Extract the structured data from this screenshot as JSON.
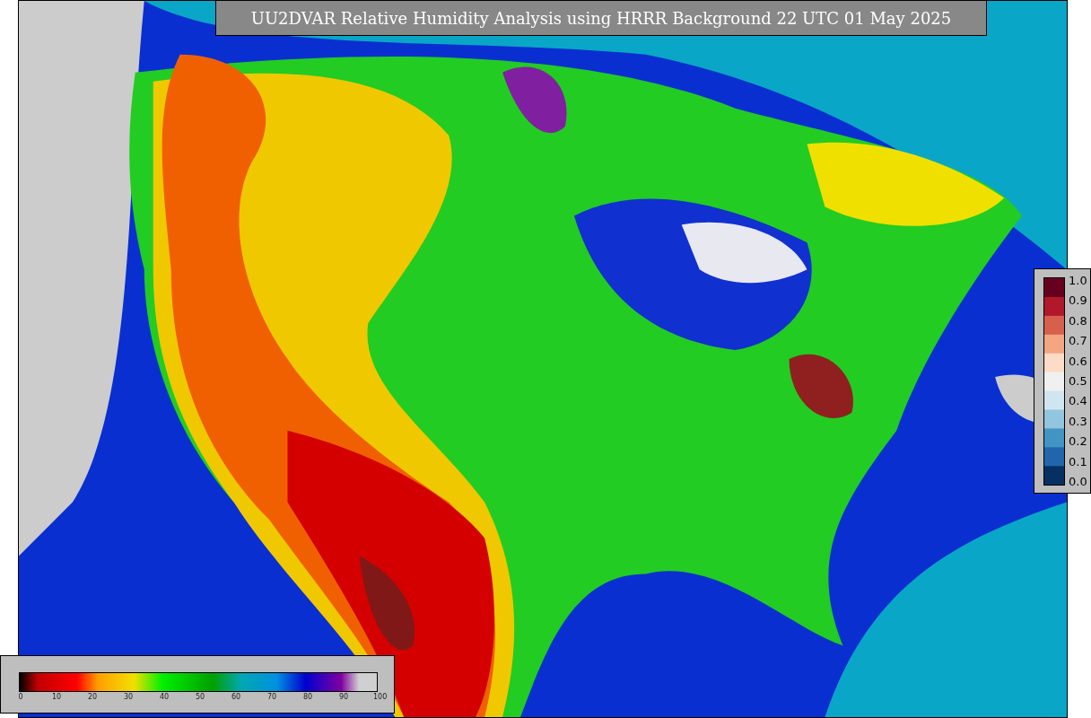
{
  "title": "UU2DVAR Relative Humidity Analysis using HRRR Background 22 UTC 01 May 2025",
  "station_legend": {
    "ticks": [
      "1.0",
      "0.9",
      "0.8",
      "0.7",
      "0.6",
      "0.5",
      "0.4",
      "0.3",
      "0.2",
      "0.1",
      "0.0"
    ]
  },
  "humidity_legend": {
    "ticks": [
      "0",
      "10",
      "20",
      "30",
      "40",
      "50",
      "60",
      "70",
      "80",
      "90",
      "100"
    ]
  }
}
